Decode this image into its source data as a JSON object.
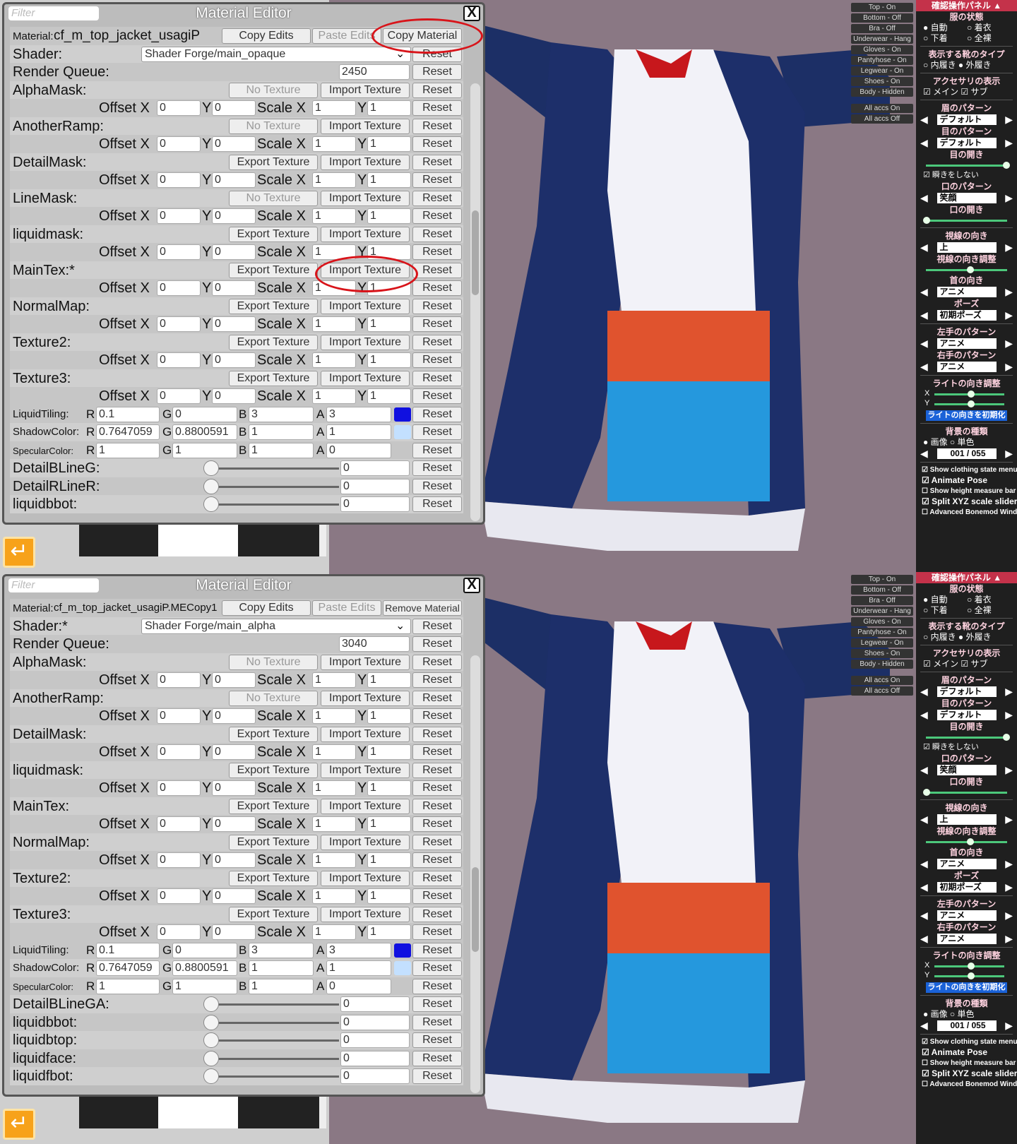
{
  "panels": [
    {
      "editor": {
        "filter_placeholder": "Filter",
        "title": "Material Editor",
        "close": "X",
        "material_label": "Material:",
        "material_name": "cf_m_top_jacket_usagiP",
        "copy_edits": "Copy Edits",
        "paste_edits": "Paste Edits",
        "material_action": "Copy Material",
        "shader_label": "Shader:",
        "shader_value": "Shader Forge/main_opaque",
        "render_queue_label": "Render Queue:",
        "render_queue_value": "2450",
        "textures": [
          {
            "name": "AlphaMask:",
            "left_btn": "No Texture",
            "left_disabled": true
          },
          {
            "name": "AnotherRamp:",
            "left_btn": "No Texture",
            "left_disabled": true
          },
          {
            "name": "DetailMask:",
            "left_btn": "Export Texture",
            "left_disabled": false
          },
          {
            "name": "LineMask:",
            "left_btn": "No Texture",
            "left_disabled": true
          },
          {
            "name": "liquidmask:",
            "left_btn": "Export Texture",
            "left_disabled": false
          },
          {
            "name": "MainTex:*",
            "left_btn": "Export Texture",
            "left_disabled": false
          },
          {
            "name": "NormalMap:",
            "left_btn": "Export Texture",
            "left_disabled": false
          },
          {
            "name": "Texture2:",
            "left_btn": "Export Texture",
            "left_disabled": false
          },
          {
            "name": "Texture3:",
            "left_btn": "Export Texture",
            "left_disabled": false
          }
        ],
        "sliders": [
          {
            "name": "DetailBLineG:",
            "value": "0"
          },
          {
            "name": "DetailRLineR:",
            "value": "0"
          },
          {
            "name": "liquidbbot:",
            "value": "0"
          }
        ]
      }
    },
    {
      "editor": {
        "filter_placeholder": "Filter",
        "title": "Material Editor",
        "close": "X",
        "material_label": "Material:",
        "material_name": "cf_m_top_jacket_usagiP.MECopy1",
        "copy_edits": "Copy Edits",
        "paste_edits": "Paste Edits",
        "material_action": "Remove Material",
        "shader_label": "Shader:*",
        "shader_value": "Shader Forge/main_alpha",
        "render_queue_label": "Render Queue:",
        "render_queue_value": "3040",
        "textures": [
          {
            "name": "AlphaMask:",
            "left_btn": "No Texture",
            "left_disabled": true
          },
          {
            "name": "AnotherRamp:",
            "left_btn": "No Texture",
            "left_disabled": true
          },
          {
            "name": "DetailMask:",
            "left_btn": "Export Texture",
            "left_disabled": false
          },
          {
            "name": "liquidmask:",
            "left_btn": "Export Texture",
            "left_disabled": false
          },
          {
            "name": "MainTex:",
            "left_btn": "Export Texture",
            "left_disabled": false
          },
          {
            "name": "NormalMap:",
            "left_btn": "Export Texture",
            "left_disabled": false
          },
          {
            "name": "Texture2:",
            "left_btn": "Export Texture",
            "left_disabled": false
          },
          {
            "name": "Texture3:",
            "left_btn": "Export Texture",
            "left_disabled": false
          }
        ],
        "sliders": [
          {
            "name": "DetailBLineGA:",
            "value": "0"
          },
          {
            "name": "liquidbbot:",
            "value": "0"
          },
          {
            "name": "liquidbtop:",
            "value": "0"
          },
          {
            "name": "liquidface:",
            "value": "0"
          },
          {
            "name": "liquidfbot:",
            "value": "0"
          }
        ]
      }
    }
  ],
  "common": {
    "import_texture": "Import Texture",
    "reset": "Reset",
    "offset_x": "Offset X",
    "y": "Y",
    "scale_x": "Scale X",
    "offset_val": "0",
    "scale_val": "1",
    "colors": [
      {
        "name": "LiquidTiling:",
        "r": "0.1",
        "g": "0",
        "b": "3",
        "a": "3",
        "swatch": "#1010e0"
      },
      {
        "name": "ShadowColor:",
        "r": "0.7647059",
        "g": "0.8800591",
        "b": "1",
        "a": "1",
        "swatch": "#c3e0ff"
      },
      {
        "name": "SpecularColor:",
        "r": "1",
        "g": "1",
        "b": "1",
        "a": "0",
        "swatch": ""
      }
    ],
    "R": "R",
    "G": "G",
    "B": "B",
    "A": "A"
  },
  "clothing_states": [
    "Top - On",
    "Bottom - Off",
    "Bra - Off",
    "Underwear - Hang",
    "Gloves - On",
    "Pantyhose - On",
    "Legwear - On",
    "Shoes - On",
    "Body - Hidden"
  ],
  "accs_buttons": [
    "All accs On",
    "All accs Off"
  ],
  "kk_panel": {
    "header": "確認操作パネル ▲",
    "clothes_state": "服の状態",
    "clothes_opts": [
      "● 自動",
      "○ 着衣",
      "○ 下着",
      "○ 全裸"
    ],
    "shoes_type": "表示する靴のタイプ",
    "shoes_opts": "○ 内履き  ● 外履き",
    "accs_display": "アクセサリの表示",
    "accs_opts": "☑ メイン ☑ サブ",
    "brow_pattern": "眉のパターン",
    "brow_value": "デフォルト",
    "eye_pattern": "目のパターン",
    "eye_value": "デフォルト",
    "eye_open": "目の開き",
    "no_blink": "☑ 瞬きをしない",
    "mouth_pattern": "口のパターン",
    "mouth_value": "笑顔",
    "mouth_open": "口の開き",
    "gaze_dir": "視線の向き",
    "gaze_value": "上",
    "gaze_adjust": "視線の向き調整",
    "neck_dir": "首の向き",
    "neck_value": "アニメ",
    "pose": "ポーズ",
    "pose_value": "初期ポーズ",
    "left_hand": "左手のパターン",
    "left_hand_value": "アニメ",
    "right_hand": "右手のパターン",
    "right_hand_value": "アニメ",
    "light_adjust": "ライトの向き調整",
    "x": "X",
    "y": "Y",
    "light_reset": "ライトの向きを初期化",
    "bg_type": "背景の種類",
    "bg_opts": "● 画像  ○ 単色",
    "bg_value": "001 / 055",
    "options": [
      "☑ Show clothing state menu",
      "☑ Animate Pose",
      "☐ Show height measure bar",
      "☑ Split XYZ scale sliders",
      "☐ Advanced Bonemod Window"
    ]
  },
  "backbutton_icon": "return-arrow-icon"
}
